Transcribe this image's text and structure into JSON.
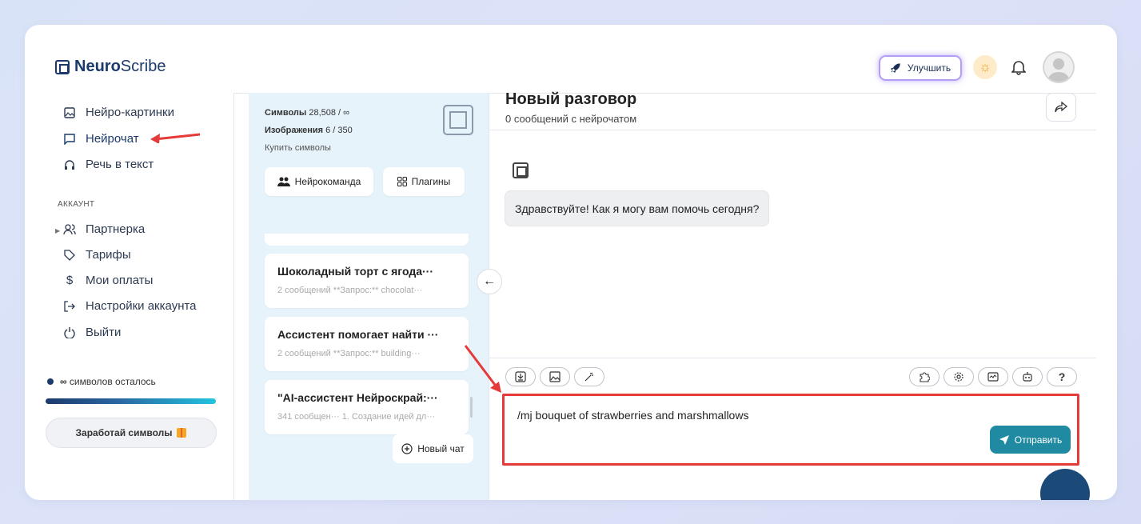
{
  "header": {
    "logo_bold": "Neuro",
    "logo_rest": "Scribe",
    "upgrade_label": "Улучшить"
  },
  "sidebar": {
    "items": [
      {
        "label": "Нейро-картинки",
        "icon": "image-icon"
      },
      {
        "label": "Нейрочат",
        "icon": "chat-icon"
      },
      {
        "label": "Речь в текст",
        "icon": "headphones-icon"
      }
    ],
    "section_account": "АККАУНТ",
    "account_items": [
      {
        "label": "Партнерка",
        "icon": "users-icon"
      },
      {
        "label": "Тарифы",
        "icon": "tag-icon"
      },
      {
        "label": "Мои оплаты",
        "icon": "dollar-icon"
      },
      {
        "label": "Настройки аккаунта",
        "icon": "login-icon"
      },
      {
        "label": "Выйти",
        "icon": "power-icon"
      }
    ],
    "symbols_infinity": "∞",
    "symbols_left": "символов осталось",
    "earn_label": "Заработай символы"
  },
  "panel": {
    "symbols_label": "Символы",
    "symbols_value": "28,508 / ∞",
    "images_label": "Изображения",
    "images_value": "6 / 350",
    "buy_label": "Купить символы",
    "team_label": "Нейрокоманда",
    "plugins_label": "Плагины",
    "chats": [
      {
        "title": "Шоколадный торт с ягода···",
        "sub": "2 сообщений   **Запрос:** chocolat···"
      },
      {
        "title": "Ассистент помогает найти ···",
        "sub": "2 сообщений   **Запрос:** building···"
      },
      {
        "title": "\"AI-ассистент Нейроскрай:···",
        "sub": "341 сообщен··· 1. Создание идей дл···"
      }
    ],
    "new_chat_label": "Новый чат"
  },
  "main": {
    "title": "Новый разговор",
    "subtitle": "0 сообщений с нейрочатом",
    "greeting": "Здравствуйте! Как я могу вам помочь сегодня?",
    "input_value": "/mj bouquet of strawberries and marshmallows",
    "send_label": "Отправить",
    "help_label": "?"
  },
  "colors": {
    "brand": "#1b3a6b",
    "send": "#1f8aa1",
    "highlight_red": "#e53a3a",
    "panel_bg": "#e6f3fb"
  }
}
